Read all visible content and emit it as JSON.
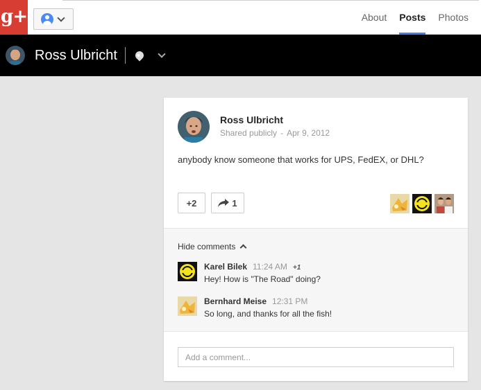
{
  "app": {
    "logo_text": "g+"
  },
  "nav": {
    "tabs": [
      "About",
      "Posts",
      "Photos"
    ],
    "active": "Posts"
  },
  "profile": {
    "name": "Ross Ulbricht"
  },
  "post": {
    "author": "Ross Ulbricht",
    "visibility": "Shared publicly",
    "date": "Apr 9, 2012",
    "text": "anybody know someone that works for UPS, FedEX, or DHL?",
    "plus_count": "+2",
    "share_count": "1"
  },
  "comments": {
    "toggle_label": "Hide comments",
    "items": [
      {
        "author": "Karel Bilek",
        "time": "11:24 AM",
        "plus": "+1",
        "text": "Hey! How is \"The Road\" doing?"
      },
      {
        "author": "Bernhard Meise",
        "time": "12:31 PM",
        "plus": "",
        "text": "So long, and thanks for all the fish!"
      }
    ]
  },
  "add_comment": {
    "placeholder": "Add a comment..."
  },
  "colors": {
    "brand_red": "#d73d32",
    "accent_blue": "#427fed",
    "profile_bar": "#000000"
  }
}
